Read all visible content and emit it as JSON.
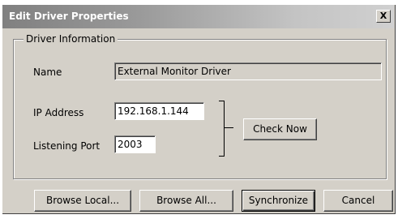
{
  "dialog": {
    "title": "Edit Driver Properties",
    "close_glyph": "X",
    "group_label": "Driver Information",
    "name_label": "Name",
    "name_value": "External Monitor Driver",
    "ip_label": "IP Address",
    "ip_value": "192.168.1.144",
    "port_label": "Listening Port",
    "port_value": "2003",
    "check_now_label": "Check Now",
    "buttons": {
      "browse_local": "Browse Local...",
      "browse_all": "Browse All...",
      "synchronize": "Synchronize",
      "cancel": "Cancel"
    }
  }
}
